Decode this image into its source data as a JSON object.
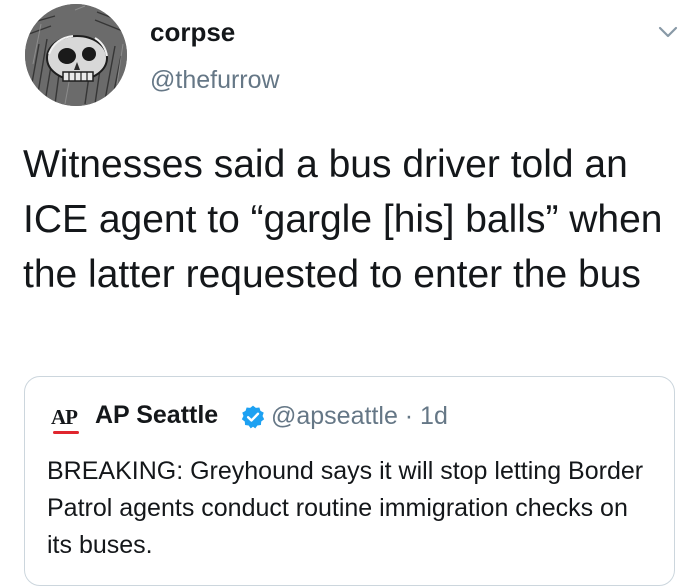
{
  "author": {
    "display_name": "corpse",
    "handle": "@thefurrow",
    "avatar_icon": "skull-illustration"
  },
  "tweet": {
    "text": "Witnesses said a bus driver told an ICE agent to “gargle [his] balls” when the latter requested to enter the bus"
  },
  "menu_icon": "chevron-down-icon",
  "quoted_tweet": {
    "logo_text": "AP",
    "display_name": "AP Seattle",
    "verified_icon": "verified-badge-icon",
    "handle_time": "@apseattle · 1d",
    "text": "BREAKING: Greyhound says it will stop letting Border Patrol agents conduct routine immigration checks on its buses."
  },
  "colors": {
    "text": "#14171a",
    "secondary": "#657786",
    "verified": "#1da1f2",
    "ap_red": "#e0262e",
    "border": "#ccd6dd"
  }
}
